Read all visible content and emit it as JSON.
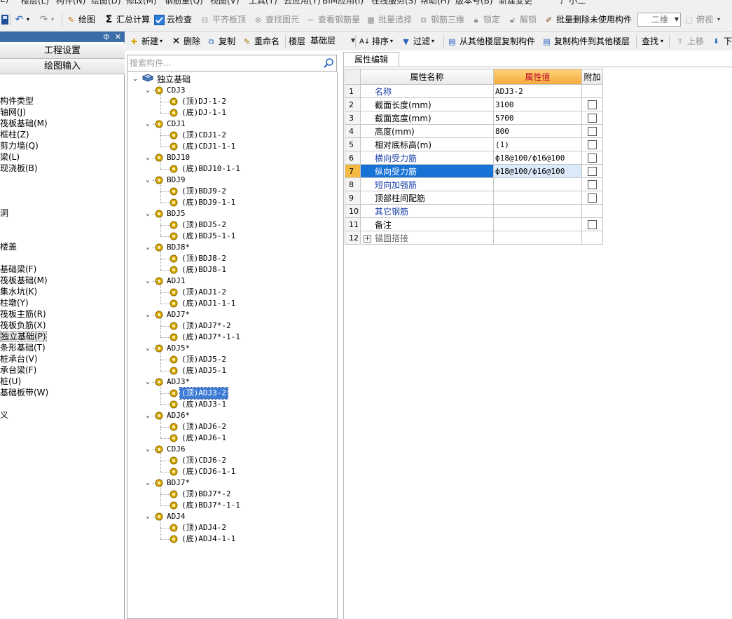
{
  "menubar": [
    "E)",
    "楼层(L)",
    "构件(N)",
    "绘图(D)",
    "修改(M)",
    "钢筋量(Q)",
    "视图(V)",
    "工具(T)",
    "云应用(Y)",
    "BIM应用(I)",
    "在线服务(S)",
    "帮助(H)",
    "版本号(B)",
    "新建变更",
    "广小二"
  ],
  "toolbar": {
    "undo": "",
    "draw": "绘图",
    "sum_calc": "汇总计算",
    "cloud_check": "云检查",
    "flush_top": "平齐板顶",
    "find_elem": "查找图元",
    "view_rebar": "查看钢筋量",
    "batch_select": "批量选择",
    "rebar_3d": "钢筋三维",
    "lock": "锁定",
    "unlock": "解锁",
    "batch_delete": "批量删除未使用构件",
    "view_mode": "二维",
    "view_dir": "俯视"
  },
  "nav": {
    "pin": "ф",
    "close": "✕",
    "buttons": [
      "工程设置",
      "绘图输入"
    ],
    "items": [
      {
        "label": "构件类型",
        "selected": false
      },
      {
        "label": "轴网(J)",
        "selected": false
      },
      {
        "label": "筏板基础(M)",
        "selected": false
      },
      {
        "label": "框柱(Z)",
        "selected": false
      },
      {
        "label": "剪力墙(Q)",
        "selected": false
      },
      {
        "label": "梁(L)",
        "selected": false
      },
      {
        "label": "现浇板(B)",
        "selected": false
      },
      {
        "label": "洞",
        "selected": false
      },
      {
        "label": "楼盖",
        "selected": false
      },
      {
        "label": "基础梁(F)",
        "selected": false
      },
      {
        "label": "筏板基础(M)",
        "selected": false
      },
      {
        "label": "集水坑(K)",
        "selected": false
      },
      {
        "label": "柱墩(Y)",
        "selected": false
      },
      {
        "label": "筏板主筋(R)",
        "selected": false
      },
      {
        "label": "筏板负筋(X)",
        "selected": false
      },
      {
        "label": "独立基础(P)",
        "selected": true
      },
      {
        "label": "条形基础(T)",
        "selected": false
      },
      {
        "label": "桩承台(V)",
        "selected": false
      },
      {
        "label": "承台梁(F)",
        "selected": false
      },
      {
        "label": "桩(U)",
        "selected": false
      },
      {
        "label": "基础板带(W)",
        "selected": false
      },
      {
        "label": "义",
        "selected": false
      }
    ]
  },
  "comp_toolbar": {
    "new": "新建",
    "delete": "删除",
    "copy": "复制",
    "rename": "重命名",
    "floor_label": "楼层",
    "floor_value": "基础层",
    "sort": "排序",
    "filter": "过滤",
    "copy_from_floor": "从其他楼层复制构件",
    "copy_to_floor": "复制构件到其他楼层",
    "find": "查找",
    "move_up": "上移",
    "move_down": "下"
  },
  "search": {
    "placeholder": "搜索构件..."
  },
  "tree": {
    "root": "独立基础",
    "groups": [
      {
        "name": "CDJ3",
        "children": [
          "(顶)DJ-1-2",
          "(底)DJ-1-1"
        ]
      },
      {
        "name": "CDJ1",
        "children": [
          "(顶)CDJ1-2",
          "(底)CDJ1-1-1"
        ]
      },
      {
        "name": "BDJ10",
        "children": [
          "(底)BDJ10-1-1"
        ]
      },
      {
        "name": "BDJ9",
        "children": [
          "(顶)BDJ9-2",
          "(底)BDJ9-1-1"
        ]
      },
      {
        "name": "BDJ5",
        "children": [
          "(顶)BDJ5-2",
          "(底)BDJ5-1-1"
        ]
      },
      {
        "name": "BDJ8*",
        "children": [
          "(顶)BDJ8-2",
          "(底)BDJ8-1"
        ]
      },
      {
        "name": "ADJ1",
        "children": [
          "(顶)ADJ1-2",
          "(底)ADJ1-1-1"
        ]
      },
      {
        "name": "ADJ7*",
        "children": [
          "(顶)ADJ7*-2",
          "(底)ADJ7*-1-1"
        ]
      },
      {
        "name": "ADJ5*",
        "children": [
          "(顶)ADJ5-2",
          "(底)ADJ5-1"
        ]
      },
      {
        "name": "ADJ3*",
        "children": [
          "(顶)ADJ3-2",
          "(底)ADJ3-1"
        ]
      },
      {
        "name": "ADJ6*",
        "children": [
          "(顶)ADJ6-2",
          "(底)ADJ6-1"
        ]
      },
      {
        "name": "CDJ6",
        "children": [
          "(顶)CDJ6-2",
          "(底)CDJ6-1-1"
        ]
      },
      {
        "name": "BDJ7*",
        "children": [
          "(顶)BDJ7*-2",
          "(底)BDJ7*-1-1"
        ]
      },
      {
        "name": "ADJ4",
        "children": [
          "(顶)ADJ4-2",
          "(底)ADJ4-1-1"
        ]
      }
    ],
    "selected": "(顶)ADJ3-2"
  },
  "props": {
    "tab": "属性编辑",
    "headers": {
      "name": "属性名称",
      "value": "属性值",
      "extra": "附加"
    },
    "rows": [
      {
        "no": "1",
        "name": "名称",
        "value": "ADJ3-2",
        "blue": true,
        "check": false
      },
      {
        "no": "2",
        "name": "截面长度(mm)",
        "value": "3100",
        "blue": false,
        "check": true
      },
      {
        "no": "3",
        "name": "截面宽度(mm)",
        "value": "5700",
        "blue": false,
        "check": true
      },
      {
        "no": "4",
        "name": "高度(mm)",
        "value": "800",
        "blue": false,
        "check": true
      },
      {
        "no": "5",
        "name": "相对底标高(m)",
        "value": "(1)",
        "blue": false,
        "check": true
      },
      {
        "no": "6",
        "name": "横向受力筋",
        "value": "ф18@100/ф16@100",
        "blue": true,
        "check": true
      },
      {
        "no": "7",
        "name": "纵向受力筋",
        "value": "ф18@100/ф16@100",
        "blue": true,
        "check": true,
        "selected": true
      },
      {
        "no": "8",
        "name": "短向加强筋",
        "value": "",
        "blue": true,
        "check": true
      },
      {
        "no": "9",
        "name": "顶部柱间配筋",
        "value": "",
        "blue": false,
        "check": true
      },
      {
        "no": "10",
        "name": "其它钢筋",
        "value": "",
        "blue": true,
        "check": false
      },
      {
        "no": "11",
        "name": "备注",
        "value": "",
        "blue": false,
        "check": true
      },
      {
        "no": "12",
        "name": "锚固搭接",
        "value": "",
        "blue": false,
        "check": false,
        "expander": "+"
      }
    ]
  }
}
